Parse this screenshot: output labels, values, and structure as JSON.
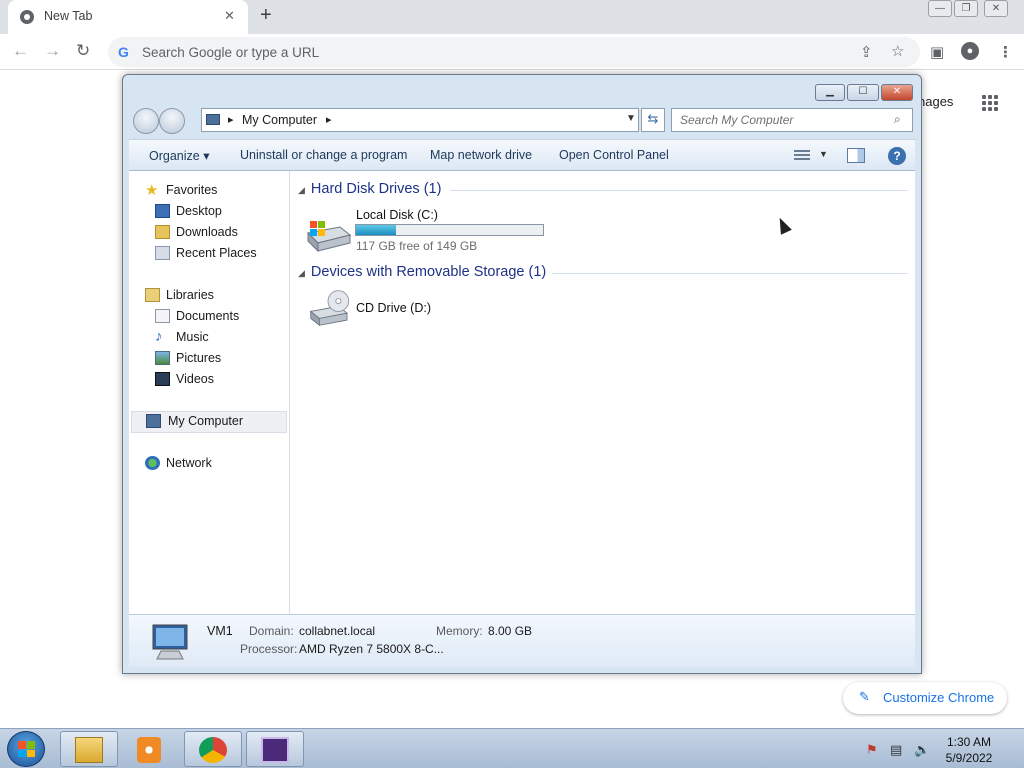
{
  "browser": {
    "tab_title": "New Tab",
    "tab_close": "✕",
    "new_tab": "+",
    "omnibox_placeholder": "Search Google or type a URL",
    "images_link_partial": "nages",
    "customize_label": "Customize Chrome",
    "icons": [
      "chrome-icon",
      "back-icon",
      "forward-icon",
      "reload-icon",
      "google-g-icon",
      "share-icon",
      "bookmark-star-icon",
      "side-panel-icon",
      "profile-icon",
      "menu-dots-icon",
      "apps-grid-icon",
      "pencil-icon"
    ]
  },
  "explorer": {
    "address_path": "My Computer",
    "search_placeholder": "Search My Computer",
    "toolbar": {
      "organize": "Organize ▾",
      "uninstall": "Uninstall or change a program",
      "map_drive": "Map network drive",
      "control_panel": "Open Control Panel"
    },
    "nav": {
      "favorites": "Favorites",
      "desktop": "Desktop",
      "downloads": "Downloads",
      "recent_places": "Recent Places",
      "libraries": "Libraries",
      "documents": "Documents",
      "music": "Music",
      "pictures": "Pictures",
      "videos": "Videos",
      "my_computer": "My Computer",
      "network": "Network"
    },
    "groups": {
      "hard_disks": "Hard Disk Drives (1)",
      "removable": "Devices with Removable Storage (1)"
    },
    "drives": {
      "local_name": "Local Disk (C:)",
      "local_free": "117 GB free of 149 GB",
      "local_used_fraction": 0.215,
      "cd_name": "CD Drive (D:)"
    },
    "details": {
      "computer_name": "VM1",
      "domain_label": "Domain:",
      "domain_value": "collabnet.local",
      "memory_label": "Memory:",
      "memory_value": "8.00 GB",
      "processor_label": "Processor:",
      "processor_value": "AMD Ryzen 7 5800X 8-C..."
    }
  },
  "taskbar": {
    "time": "1:30 AM",
    "date": "5/9/2022",
    "pinned": [
      "file-explorer-icon",
      "media-player-icon",
      "chrome-icon",
      "app-icon"
    ]
  },
  "colors": {
    "chrome_tabstrip": "#dee1e6",
    "explorer_frame": "#d7e4f2",
    "link_blue": "#1a73e8",
    "group_head_blue": "#1e3287",
    "drive_bar_fill": "#1b8fc0"
  }
}
